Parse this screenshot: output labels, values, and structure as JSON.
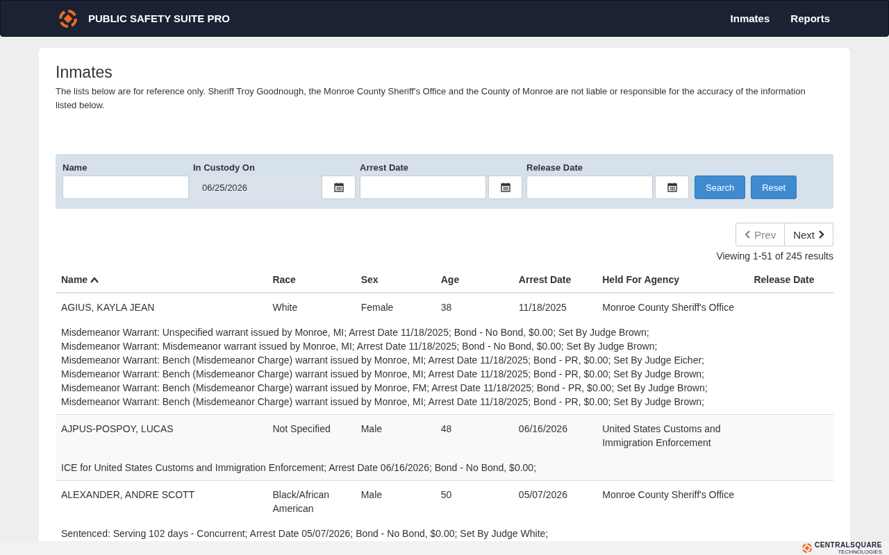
{
  "navbar": {
    "brand": "PUBLIC SAFETY SUITE PRO",
    "links": [
      {
        "label": "Inmates"
      },
      {
        "label": "Reports"
      }
    ]
  },
  "page": {
    "title": "Inmates",
    "disclaimer": "The lists below are for reference only.  Sheriff Troy Goodnough, the Monroe County Sheriff's Office and the County of Monroe are not liable or responsible for the accuracy of the information listed below."
  },
  "filters": {
    "fields": [
      {
        "label": "Name",
        "kind": "text",
        "disabled": false
      },
      {
        "label": "In Custody On",
        "value": "06/25/2026",
        "kind": "date",
        "disabled": true
      },
      {
        "label": "Arrest Date",
        "kind": "date",
        "disabled": false
      },
      {
        "label": "Release Date",
        "kind": "date",
        "disabled": false
      }
    ],
    "buttons": [
      "Search",
      "Reset"
    ]
  },
  "pagination": {
    "prev": "Prev",
    "next": "Next",
    "summary": "Viewing 1-51 of 245 results"
  },
  "table": {
    "columns": [
      {
        "label": "Name",
        "sorted": true
      },
      {
        "label": "Race",
        "sorted": false
      },
      {
        "label": "Sex",
        "sorted": false
      },
      {
        "label": "Age",
        "sorted": false
      },
      {
        "label": "Arrest Date",
        "sorted": false
      },
      {
        "label": "Held For Agency",
        "sorted": false
      },
      {
        "label": "Release Date",
        "sorted": false
      }
    ],
    "rows": [
      {
        "cells": [
          "AGIUS, KAYLA JEAN",
          "White",
          "Female",
          "38",
          "11/18/2025",
          "Monroe County Sheriff's Office",
          ""
        ],
        "details": [
          "Misdemeanor Warrant: Unspecified warrant issued by Monroe, MI; Arrest Date 11/18/2025; Bond - No Bond, $0.00; Set By Judge Brown;",
          "Misdemeanor Warrant: Misdemeanor warrant issued by Monroe, MI; Arrest Date 11/18/2025; Bond - No Bond, $0.00; Set By Judge Brown;",
          "Misdemeanor Warrant: Bench (Misdemeanor Charge) warrant issued by Monroe, MI; Arrest Date 11/18/2025; Bond - PR, $0.00; Set By Judge Eicher;",
          "Misdemeanor Warrant: Bench (Misdemeanor Charge) warrant issued by Monroe, MI; Arrest Date 11/18/2025; Bond - PR, $0.00; Set By Judge Brown;",
          "Misdemeanor Warrant: Bench (Misdemeanor Charge) warrant issued by Monroe, FM; Arrest Date 11/18/2025; Bond - PR, $0.00; Set By Judge Brown;",
          "Misdemeanor Warrant: Bench (Misdemeanor Charge) warrant issued by Monroe, MI; Arrest Date 11/18/2025; Bond - PR, $0.00; Set By Judge Brown;"
        ]
      },
      {
        "cells": [
          "AJPUS-POSPOY, LUCAS",
          "Not Specified",
          "Male",
          "48",
          "06/16/2026",
          "United States Customs and Immigration Enforcement",
          ""
        ],
        "details": [
          "ICE for United States Customs and Immigration Enforcement; Arrest Date 06/16/2026; Bond - No Bond, $0.00;"
        ]
      },
      {
        "cells": [
          "ALEXANDER, ANDRE SCOTT",
          "Black/African American",
          "Male",
          "50",
          "05/07/2026",
          "Monroe County Sheriff's Office",
          ""
        ],
        "details": [
          "Sentenced: Serving 102 days - Concurrent; Arrest Date 05/07/2026; Bond - No Bond, $0.00; Set By Judge White;"
        ]
      }
    ]
  },
  "footer": {
    "logo": "CENTRALSQUARE",
    "tagline": "TECHNOLOGIES"
  }
}
